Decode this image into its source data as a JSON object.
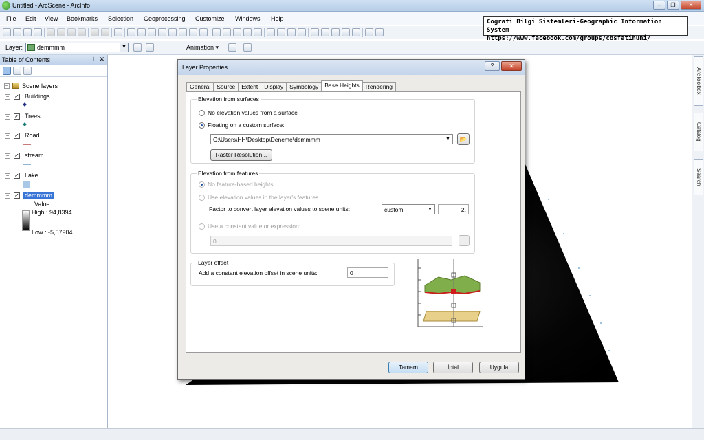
{
  "app": {
    "title": "Untitled - ArcScene - ArcInfo"
  },
  "menu": [
    "File",
    "Edit",
    "View",
    "Bookmarks",
    "Selection",
    "Geoprocessing",
    "Customize",
    "Windows",
    "Help"
  ],
  "toolbar": {
    "layer_label": "Layer:",
    "layer_value": "demmmm",
    "animation_label": "Animation"
  },
  "banner": {
    "line1": "Coğrafi Bilgi Sistemleri-Geographic Information System",
    "line2": "https://www.facebook.com/groups/cbsfatihuni/"
  },
  "toc": {
    "title": "Table of Contents",
    "root": "Scene layers",
    "layers": [
      "Buildings",
      "Trees",
      "Road",
      "stream",
      "Lake",
      "demmmm"
    ],
    "legend": {
      "value_label": "Value",
      "high": "High : 94,8394",
      "low": "Low : -5,57904"
    }
  },
  "side_tabs": [
    "ArcToolbox",
    "Catalog",
    "Search"
  ],
  "dialog": {
    "title": "Layer Properties",
    "tabs": [
      "General",
      "Source",
      "Extent",
      "Display",
      "Symbology",
      "Base Heights",
      "Rendering"
    ],
    "active_tab": "Base Heights",
    "surfaces": {
      "group_label": "Elevation from surfaces",
      "opt_none": "No elevation values from a surface",
      "opt_floating": "Floating on a custom surface:",
      "surface_path": "C:\\Users\\HH\\Desktop\\Deneme\\demmmm",
      "raster_button": "Raster Resolution..."
    },
    "features": {
      "group_label": "Elevation from features",
      "opt_none": "No feature-based heights",
      "opt_use": "Use elevation values in the layer's features",
      "factor_label": "Factor to convert layer elevation values to scene units:",
      "factor_unit": "custom",
      "factor_value": "2,",
      "opt_constant": "Use a constant value or expression:",
      "constant_value": "0"
    },
    "offset": {
      "group_label": "Layer offset",
      "label": "Add a constant elevation offset in scene units:",
      "value": "0"
    },
    "buttons": {
      "ok": "Tamam",
      "cancel": "İptal",
      "apply": "Uygula"
    }
  },
  "colors": {
    "selection": "#3875d7",
    "titlebar": "#c3d4ea",
    "dem_high": "#ffffff",
    "dem_low": "#000000"
  }
}
